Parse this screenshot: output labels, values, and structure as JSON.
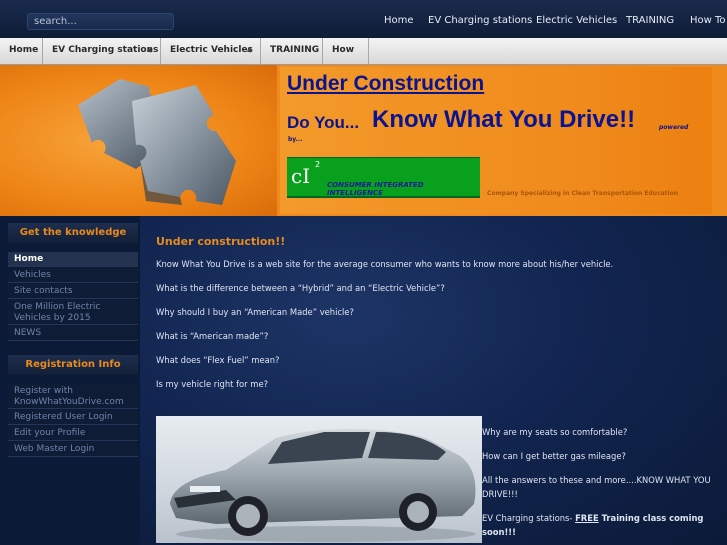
{
  "topbar": {
    "search_placeholder": "search...",
    "nav": [
      "Home",
      "EV Charging stations",
      "Electric Vehicles",
      "TRAINING",
      "How To"
    ]
  },
  "menu": {
    "items": [
      "Home",
      "EV Charging stations",
      "Electric Vehicles",
      "TRAINING",
      "How To"
    ]
  },
  "banner": {
    "heading": "Under Construction",
    "do_you": "Do You...",
    "tagline": "Know What You Drive!!",
    "powered": "powered",
    "by": "by...",
    "logo_mark": "cI",
    "logo_sup": "2",
    "logo_text": "CONSUMER INTEGRATED INTELLIGENCE",
    "company": "Company Specializing in Clean Transportation Education"
  },
  "sidebar": {
    "knowledge_title": "Get the knowledge",
    "knowledge_items": [
      "Home",
      "Vehicles",
      "Site contacts",
      "One Million Electric Vehicles by 2015",
      "NEWS"
    ],
    "registration_title": "Registration Info",
    "registration_items": [
      "Register with KnowWhatYouDrive.com",
      "Registered User Login",
      "Edit your Profile",
      "Web Master Login"
    ]
  },
  "content": {
    "title": "Under construction!!",
    "lines": [
      "Know What You Drive is a web site for the average consumer who wants to know more about his/her vehicle.",
      "What is the difference between a “Hybrid” and an “Electric Vehicle”?",
      "Why should I buy an “American Made” vehicle?",
      "What is “American made”?",
      "What does “Flex Fuel” mean?",
      "Is my vehicle right for me?"
    ],
    "right_lines": [
      "Why are my seats so comfortable?",
      "How can I get better gas mileage?",
      "All the answers to these and more....KNOW WHAT YOU",
      "DRIVE!!!"
    ],
    "ev_prefix": "EV Charging stations- ",
    "ev_free": "FREE",
    "ev_suffix": " Training class coming",
    "ev_soon": "soon!!!"
  }
}
